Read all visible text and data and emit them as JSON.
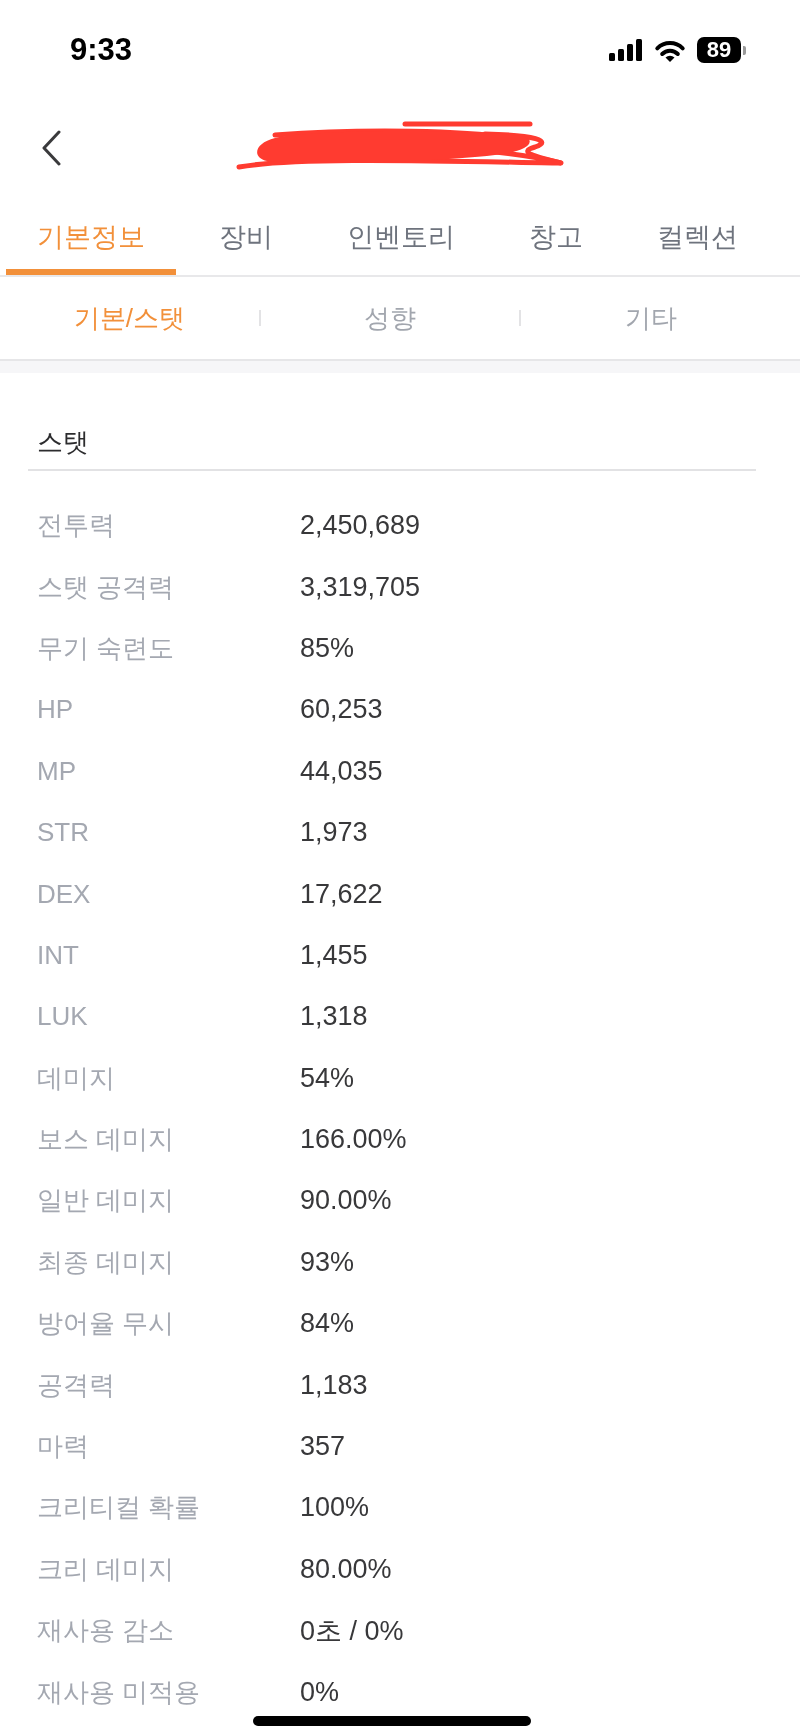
{
  "status_bar": {
    "time": "9:33",
    "battery": "89"
  },
  "tabs": [
    {
      "label": "기본정보",
      "selected": true
    },
    {
      "label": "장비",
      "selected": false
    },
    {
      "label": "인벤토리",
      "selected": false
    },
    {
      "label": "창고",
      "selected": false
    },
    {
      "label": "컬렉션",
      "selected": false
    }
  ],
  "sub_tabs": [
    {
      "label": "기본/스탯",
      "selected": true
    },
    {
      "label": "성향",
      "selected": false
    },
    {
      "label": "기타",
      "selected": false
    }
  ],
  "section": {
    "title": "스탯",
    "rows": [
      {
        "label": "전투력",
        "value": "2,450,689"
      },
      {
        "label": "스탯 공격력",
        "value": "3,319,705"
      },
      {
        "label": "무기 숙련도",
        "value": "85%"
      },
      {
        "label": "HP",
        "value": "60,253"
      },
      {
        "label": "MP",
        "value": "44,035"
      },
      {
        "label": "STR",
        "value": "1,973"
      },
      {
        "label": "DEX",
        "value": "17,622"
      },
      {
        "label": "INT",
        "value": "1,455"
      },
      {
        "label": "LUK",
        "value": "1,318"
      },
      {
        "label": "데미지",
        "value": "54%"
      },
      {
        "label": "보스 데미지",
        "value": "166.00%"
      },
      {
        "label": "일반 데미지",
        "value": "90.00%"
      },
      {
        "label": "최종 데미지",
        "value": "93%"
      },
      {
        "label": "방어율 무시",
        "value": "84%"
      },
      {
        "label": "공격력",
        "value": "1,183"
      },
      {
        "label": "마력",
        "value": "357"
      },
      {
        "label": "크리티컬 확률",
        "value": "100%"
      },
      {
        "label": "크리 데미지",
        "value": "80.00%"
      },
      {
        "label": "재사용 감소",
        "value": "0초 / 0%"
      },
      {
        "label": "재사용 미적용",
        "value": "0%"
      }
    ]
  }
}
